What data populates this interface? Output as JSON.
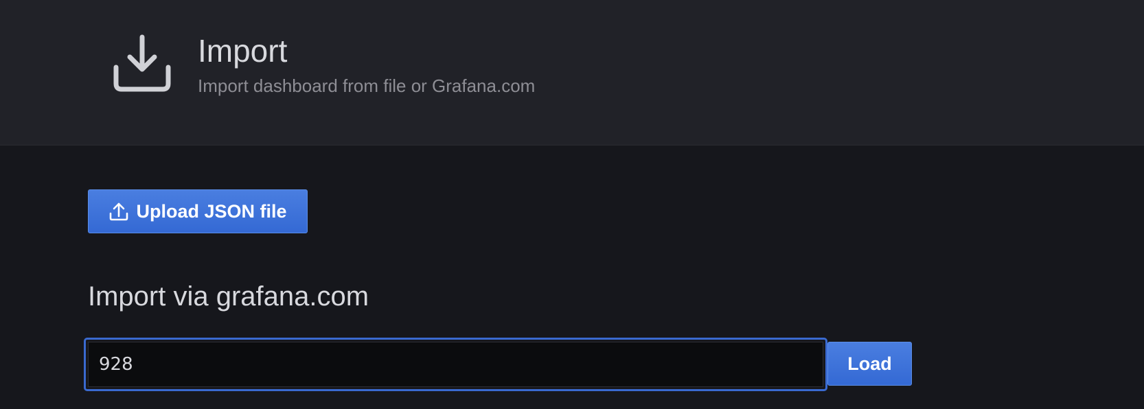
{
  "header": {
    "title": "Import",
    "subtitle": "Import dashboard from file or Grafana.com",
    "icon": "import-download-icon"
  },
  "upload": {
    "label": "Upload JSON file",
    "icon": "upload-icon"
  },
  "grafana_com": {
    "title": "Import via grafana.com",
    "input_value": "928",
    "load_label": "Load"
  },
  "colors": {
    "header_bg": "#212228",
    "body_bg": "#16171c",
    "primary": "#3d71d9",
    "text_primary": "#d8d9de",
    "text_secondary": "#8e8e95"
  }
}
